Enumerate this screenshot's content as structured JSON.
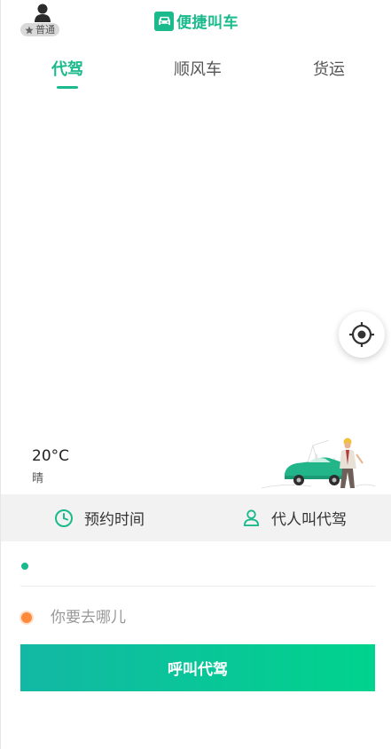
{
  "header": {
    "member_badge": "普通",
    "app_title": "便捷叫车"
  },
  "tabs": [
    {
      "label": "代驾",
      "active": true
    },
    {
      "label": "顺风车",
      "active": false
    },
    {
      "label": "货运",
      "active": false
    }
  ],
  "weather": {
    "temperature": "20°C",
    "condition": "晴"
  },
  "options": {
    "schedule_label": "预约时间",
    "proxy_label": "代人叫代驾"
  },
  "route": {
    "start_value": "",
    "destination_placeholder": "你要去哪儿"
  },
  "action": {
    "call_label": "呼叫代驾"
  },
  "colors": {
    "brand": "#1aba8c",
    "destination_dot": "#ff8a3c",
    "button_gradient_start": "#13b8a4",
    "button_gradient_end": "#00d38d"
  },
  "icons": [
    "user-avatar-icon",
    "star-icon",
    "car-logo-icon",
    "locate-target-icon",
    "clock-icon",
    "person-icon"
  ]
}
